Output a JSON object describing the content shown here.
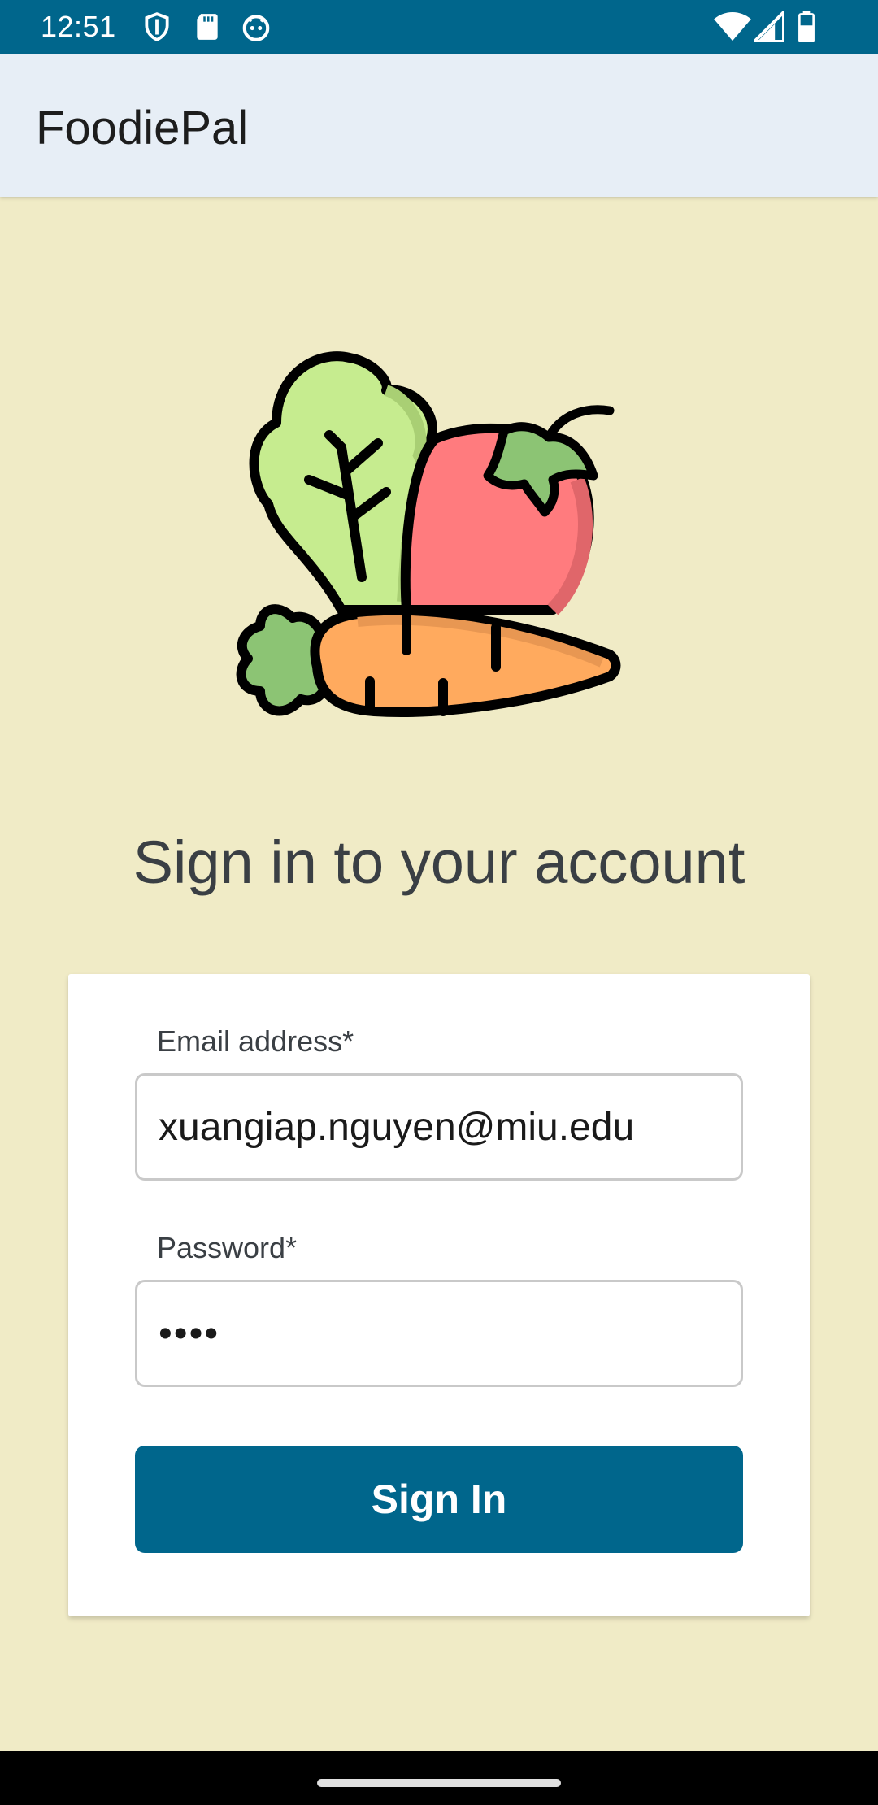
{
  "status_bar": {
    "time": "12:51",
    "icons_left": [
      "shield-icon",
      "sd-card-icon",
      "android-icon"
    ],
    "icons_right": [
      "wifi-icon",
      "signal-icon",
      "battery-icon"
    ],
    "background": "#00668c"
  },
  "app_bar": {
    "title": "FoodiePal"
  },
  "hero": {
    "icon": "vegetables-illustration"
  },
  "heading": "Sign in to your account",
  "form": {
    "email": {
      "label": "Email address*",
      "value": "xuangiap.nguyen@miu.edu"
    },
    "password": {
      "label": "Password*",
      "value": "••••"
    },
    "submit_label": "Sign In"
  },
  "colors": {
    "accent": "#00668c",
    "background": "#f0ebc6",
    "app_bar": "#e7eef6"
  }
}
